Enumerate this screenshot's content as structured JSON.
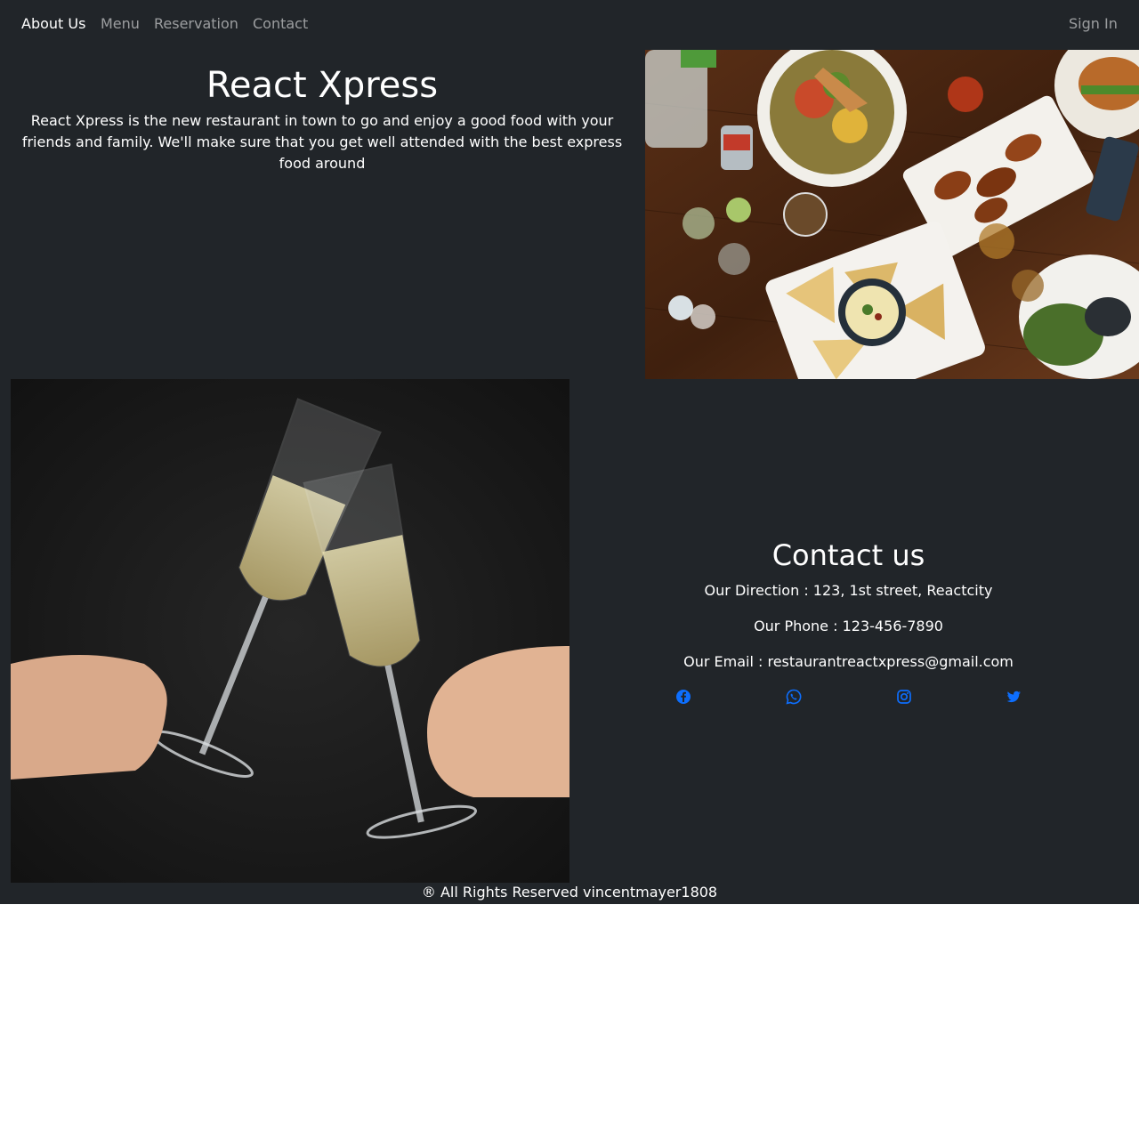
{
  "nav": {
    "items": [
      {
        "label": "About Us"
      },
      {
        "label": "Menu"
      },
      {
        "label": "Reservation"
      },
      {
        "label": "Contact"
      }
    ],
    "sign_in": "Sign In"
  },
  "hero": {
    "title": "React Xpress",
    "description": "React Xpress is the new restaurant in town to go and enjoy a good food with your friends and family. We'll make sure that you get well attended with the best express food around"
  },
  "contact": {
    "title": "Contact us",
    "direction": "Our Direction : 123, 1st street, Reactcity",
    "phone": "Our Phone : 123-456-7890",
    "email": "Our Email : restaurantreactxpress@gmail.com",
    "social_icons": [
      "facebook-icon",
      "whatsapp-icon",
      "instagram-icon",
      "twitter-icon"
    ]
  },
  "footer": {
    "text": "® All Rights Reserved vincentmayer1808"
  },
  "colors": {
    "background": "#212529",
    "nav_inactive": "#8c8f92",
    "link_accent": "#0d6efd",
    "below_fold": "#ffffff"
  }
}
